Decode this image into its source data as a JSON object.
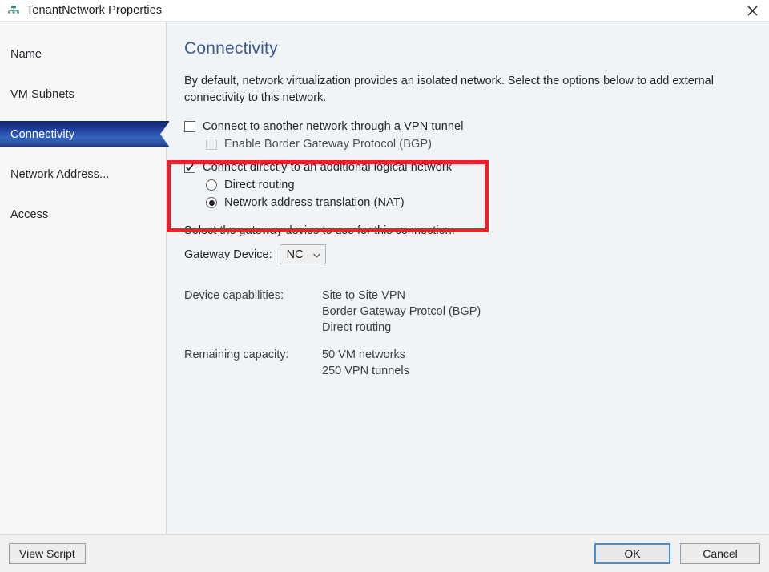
{
  "window": {
    "title": "TenantNetwork Properties",
    "icon": "network-properties-icon",
    "close_icon": "close-icon"
  },
  "sidebar": {
    "items": [
      {
        "label": "Name",
        "selected": false
      },
      {
        "label": "VM Subnets",
        "selected": false
      },
      {
        "label": "Connectivity",
        "selected": true
      },
      {
        "label": "Network Address...",
        "selected": false
      },
      {
        "label": "Access",
        "selected": false
      }
    ]
  },
  "content": {
    "title": "Connectivity",
    "intro": "By default, network virtualization provides an isolated network. Select the options below to add external connectivity to this network.",
    "options": {
      "vpn_tunnel": {
        "label": "Connect to another network through a VPN tunnel",
        "checked": false,
        "enabled": true
      },
      "bgp": {
        "label": "Enable Border Gateway Protocol (BGP)",
        "checked": false,
        "enabled": false
      },
      "logical_network": {
        "label": "Connect directly to an additional logical network",
        "checked": true,
        "enabled": true
      },
      "direct_routing": {
        "label": "Direct routing",
        "selected": false
      },
      "nat": {
        "label": "Network address translation (NAT)",
        "selected": true
      }
    },
    "gateway": {
      "caption": "Select the gateway device to use for this connection.",
      "label": "Gateway Device:",
      "value": "NC",
      "caret_icon": "chevron-down-icon"
    },
    "info": [
      {
        "key": "Device capabilities:",
        "values": [
          "Site to Site VPN",
          "Border Gateway Protcol (BGP)",
          "Direct routing"
        ]
      },
      {
        "key": "Remaining capacity:",
        "values": [
          "50 VM networks",
          "250 VPN tunnels"
        ]
      }
    ],
    "highlight_color": "#e8212b"
  },
  "footer": {
    "view_script": "View Script",
    "ok": "OK",
    "cancel": "Cancel"
  },
  "colors": {
    "accent": "#3f5b90",
    "selection": "#1d3a96",
    "highlight": "#e8212b",
    "focus": "#3f93d4"
  }
}
